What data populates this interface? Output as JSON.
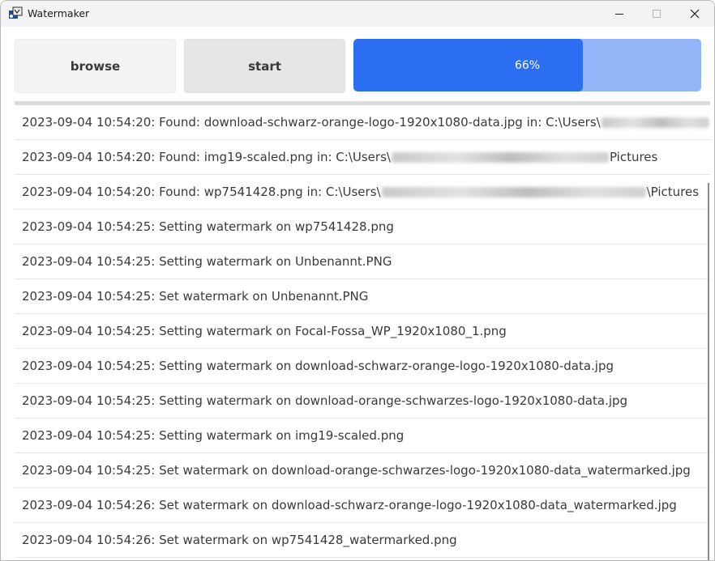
{
  "window": {
    "title": "Watermaker",
    "icon": "watermaker-app-icon"
  },
  "controls": {
    "minimize": "minimize-icon",
    "maximize": "maximize-icon",
    "close": "close-icon"
  },
  "toolbar": {
    "browse_label": "browse",
    "start_label": "start"
  },
  "progress": {
    "value": 0.66,
    "label": "66%"
  },
  "log": [
    {
      "prefix": "2023-09-04 10:54:20: Found: download-schwarz-orange-logo-1920x1080-data.jpg in: C:\\Users\\",
      "redacted": true,
      "suffix": ""
    },
    {
      "prefix": "2023-09-04 10:54:20: Found: img19-scaled.png in: C:\\Users\\",
      "redacted": true,
      "suffix": "Pictures"
    },
    {
      "prefix": "2023-09-04 10:54:20: Found: wp7541428.png in: C:\\Users\\",
      "redacted": true,
      "suffix": "\\Pictures"
    },
    {
      "prefix": "2023-09-04 10:54:25: Setting watermark on wp7541428.png",
      "redacted": false,
      "suffix": ""
    },
    {
      "prefix": "2023-09-04 10:54:25: Setting watermark on Unbenannt.PNG",
      "redacted": false,
      "suffix": ""
    },
    {
      "prefix": "2023-09-04 10:54:25: Set watermark on Unbenannt.PNG",
      "redacted": false,
      "suffix": ""
    },
    {
      "prefix": "2023-09-04 10:54:25: Setting watermark on Focal-Fossa_WP_1920x1080_1.png",
      "redacted": false,
      "suffix": ""
    },
    {
      "prefix": "2023-09-04 10:54:25: Setting watermark on download-schwarz-orange-logo-1920x1080-data.jpg",
      "redacted": false,
      "suffix": ""
    },
    {
      "prefix": "2023-09-04 10:54:25: Setting watermark on download-orange-schwarzes-logo-1920x1080-data.jpg",
      "redacted": false,
      "suffix": ""
    },
    {
      "prefix": "2023-09-04 10:54:25: Setting watermark on img19-scaled.png",
      "redacted": false,
      "suffix": ""
    },
    {
      "prefix": "2023-09-04 10:54:25: Set watermark on download-orange-schwarzes-logo-1920x1080-data_watermarked.jpg",
      "redacted": false,
      "suffix": ""
    },
    {
      "prefix": "2023-09-04 10:54:26: Set watermark on download-schwarz-orange-logo-1920x1080-data_watermarked.jpg",
      "redacted": false,
      "suffix": ""
    },
    {
      "prefix": "2023-09-04 10:54:26: Set watermark on wp7541428_watermarked.png",
      "redacted": false,
      "suffix": ""
    }
  ]
}
